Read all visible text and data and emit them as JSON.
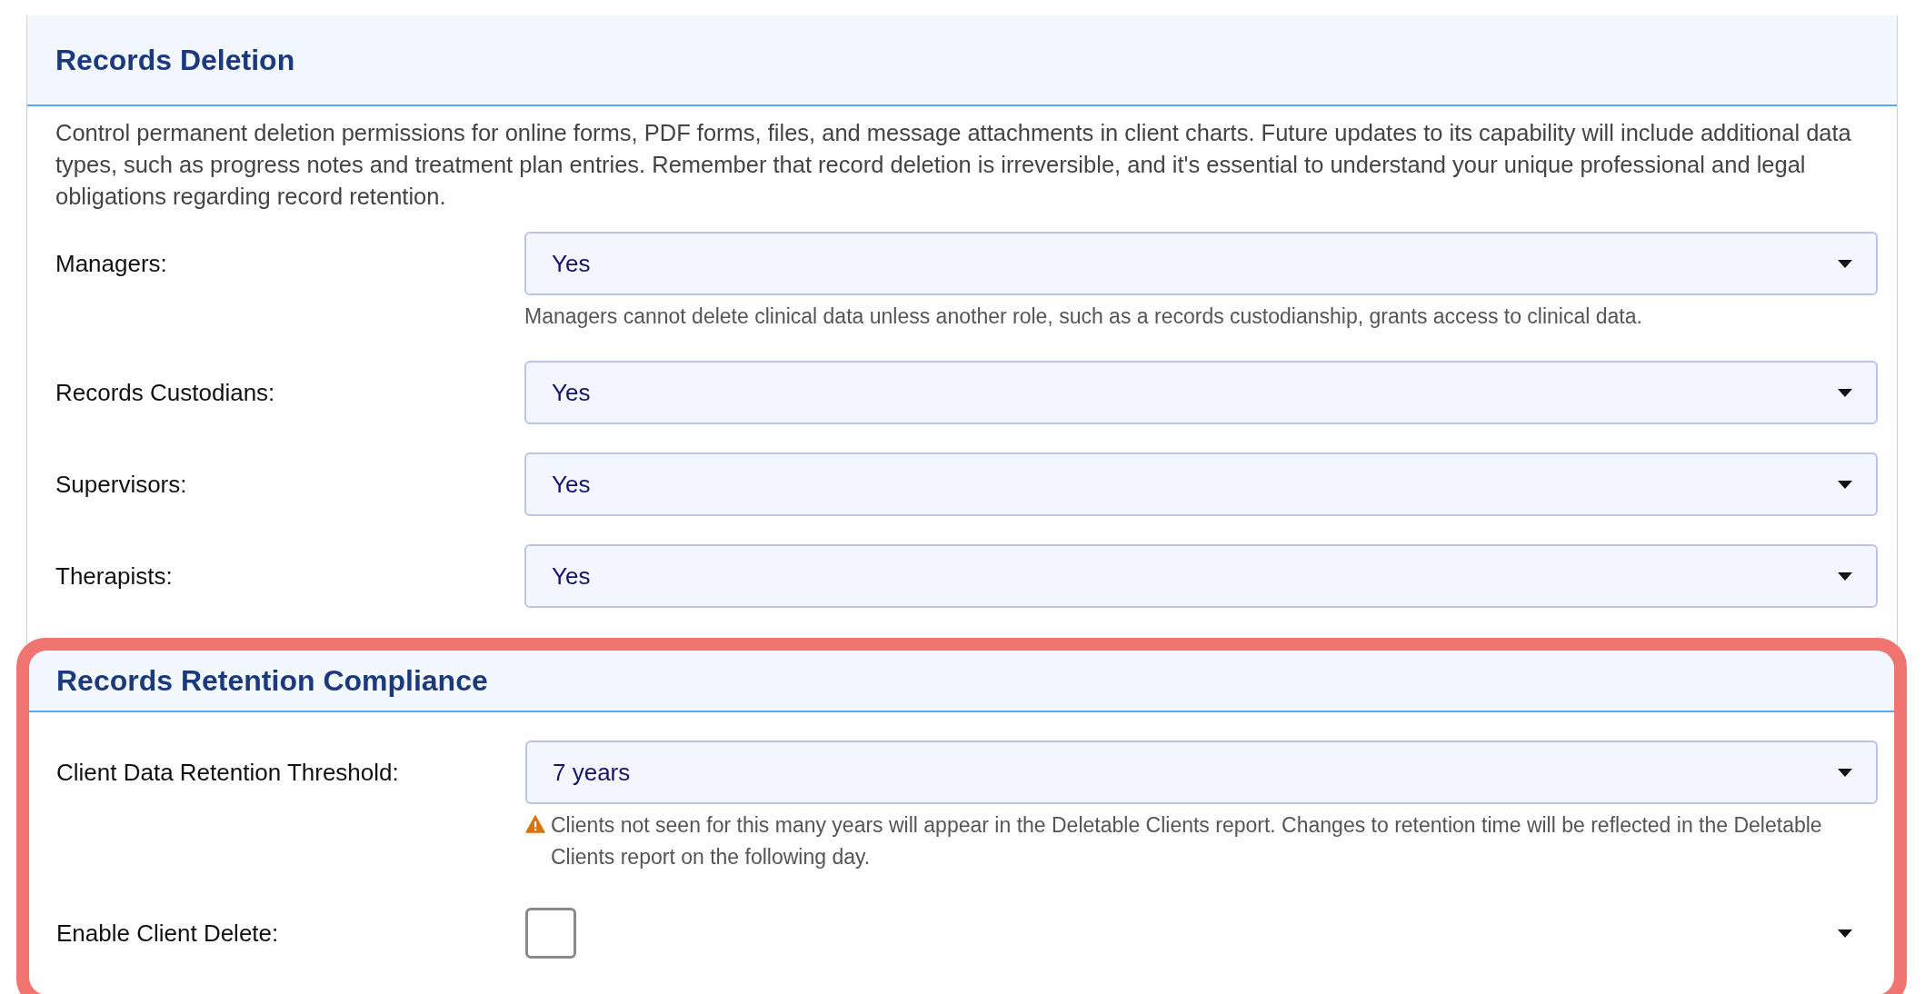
{
  "sections": [
    {
      "title": "Records Deletion",
      "highlighted": false,
      "description": "Control permanent deletion permissions for online forms, PDF forms, files, and message attachments in client charts. Future updates to its capability will include additional data types, such as progress notes and treatment plan entries. Remember that record deletion is irreversible, and it's essential to understand your unique professional and legal obligations regarding record retention.",
      "fields": [
        {
          "kind": "select",
          "label": "Managers:",
          "value": "Yes",
          "help": {
            "kind": "plain",
            "text": "Managers cannot delete clinical data unless another role, such as a records custodianship, grants access to clinical data."
          }
        },
        {
          "kind": "select",
          "label": "Records Custodians:",
          "value": "Yes"
        },
        {
          "kind": "select",
          "label": "Supervisors:",
          "value": "Yes"
        },
        {
          "kind": "select",
          "label": "Therapists:",
          "value": "Yes"
        }
      ]
    },
    {
      "title": "Records Retention Compliance",
      "highlighted": true,
      "fields": [
        {
          "kind": "select",
          "label": "Client Data Retention Threshold:",
          "value": "7 years",
          "help": {
            "kind": "warning",
            "text": "Clients not seen for this many years will appear in the Deletable Clients report. Changes to retention time will be reflected in the Deletable Clients report on the following day."
          }
        },
        {
          "kind": "checkbox",
          "label": "Enable Client Delete:",
          "checked": false
        }
      ]
    }
  ]
}
